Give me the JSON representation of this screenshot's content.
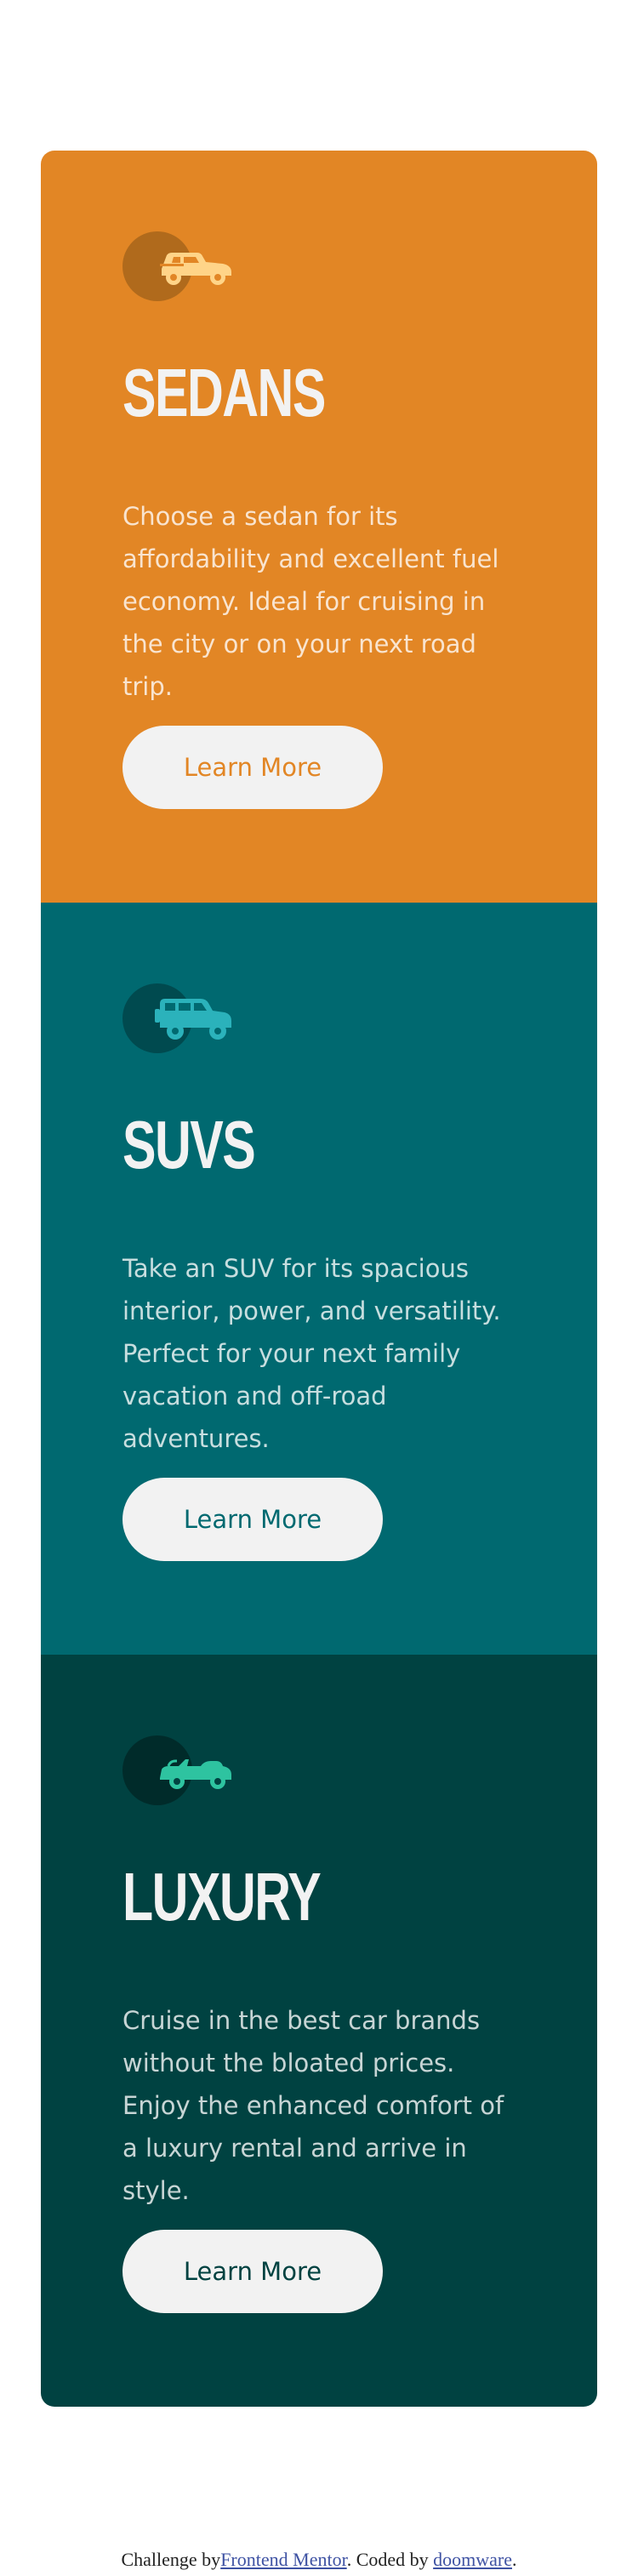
{
  "cards": [
    {
      "icon": "sedan-car-icon",
      "title": "SEDANS",
      "text": "Choose a sedan for its affordability and excellent fuel economy. Ideal for cruising in the city or on your next road trip.",
      "button": "Learn More",
      "background": "#e28625"
    },
    {
      "icon": "suv-car-icon",
      "title": "SUVS",
      "text": "Take an SUV for its spacious interior, power, and versatility. Perfect for your next family vacation and off-road adventures.",
      "button": "Learn More",
      "background": "#006970"
    },
    {
      "icon": "luxury-car-icon",
      "title": "LUXURY",
      "text": "Cruise in the best car brands without the bloated prices. Enjoy the enhanced comfort of a luxury rental and arrive in style.",
      "button": "Learn More",
      "background": "#004241"
    }
  ],
  "attribution": {
    "prefix": "Challenge by",
    "link1": "Frontend Mentor",
    "middle": ". Coded by ",
    "link2": "doomware",
    "suffix": "."
  },
  "colors": {
    "button_bg": "#f2f2f2",
    "title": "#f2f2f2",
    "link": "#3e52a3"
  }
}
